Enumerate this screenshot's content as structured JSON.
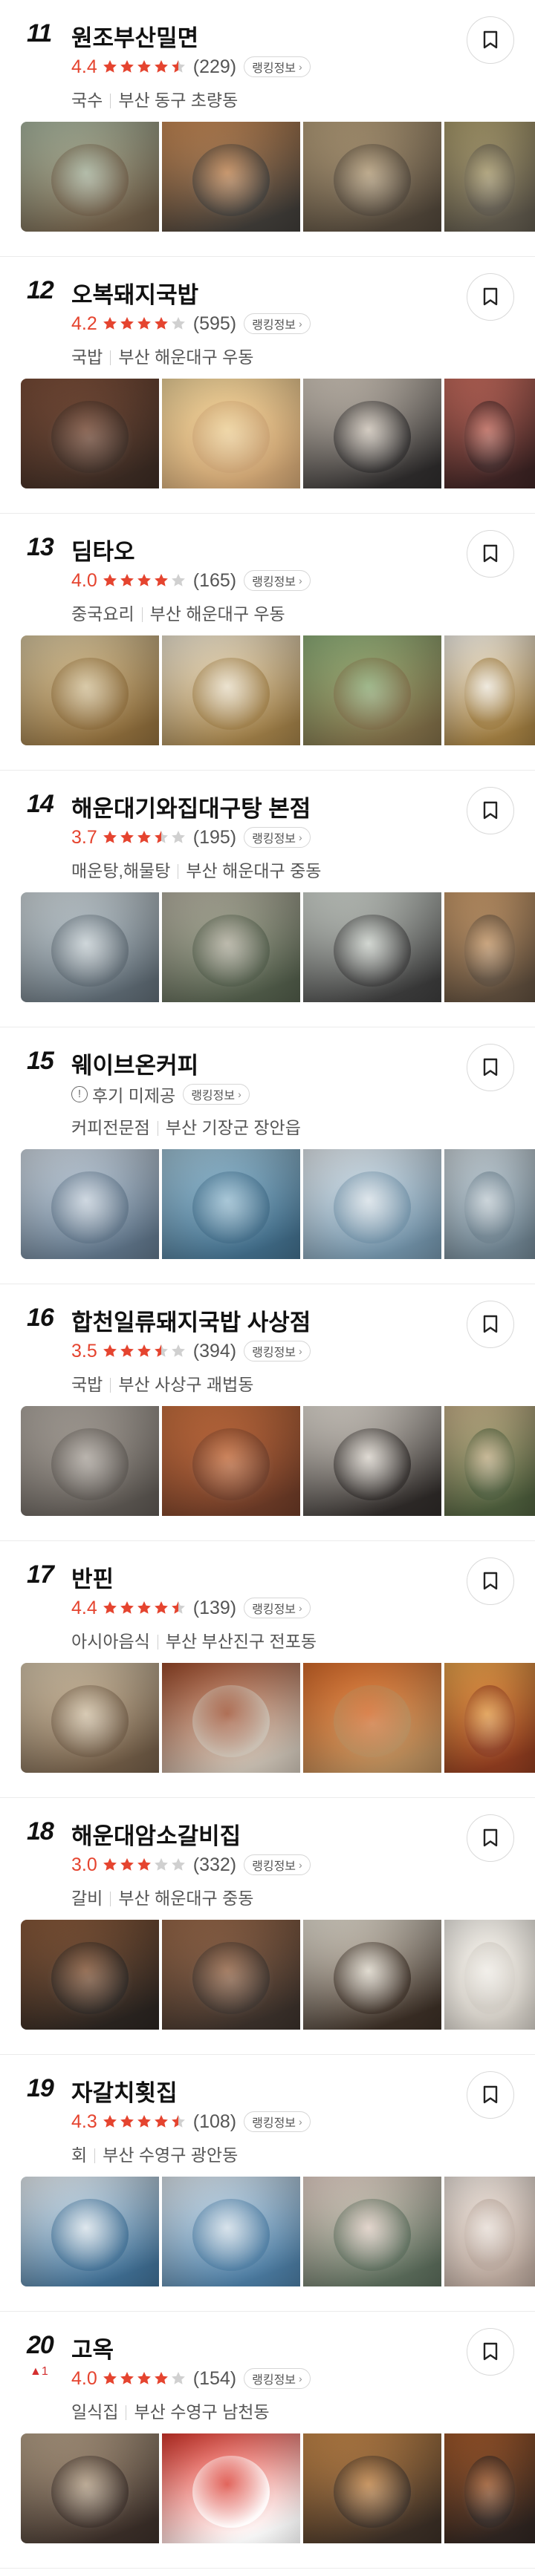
{
  "accent": "#e5442f",
  "star_color": "#e5442f",
  "star_empty": "#d0d0d0",
  "badge_label": "랭킹정보",
  "items": [
    {
      "rank": "11",
      "name": "원조부산밀면",
      "score": "4.4",
      "stars": 4.5,
      "reviews": "(229)",
      "category": "국수",
      "location": "부산 동구 초량동",
      "photos": [
        {
          "subject": "noodle-dishes-table",
          "c1": "#6b5a45",
          "c2": "#a9b7a0"
        },
        {
          "subject": "milmyeon-bowl",
          "c1": "#3d3a36",
          "c2": "#c88a55"
        },
        {
          "subject": "noodles-with-kimchi",
          "c1": "#4e4438",
          "c2": "#b9a27d"
        },
        {
          "subject": "cold-noodle-bowl",
          "c1": "#5a5448",
          "c2": "#a99b6c"
        }
      ]
    },
    {
      "rank": "12",
      "name": "오복돼지국밥",
      "score": "4.2",
      "stars": 4.0,
      "reviews": "(595)",
      "category": "국밥",
      "location": "부산 해운대구 우동",
      "photos": [
        {
          "subject": "soondae-plate",
          "c1": "#3a2a22",
          "c2": "#7a4d38"
        },
        {
          "subject": "noodles-lifted",
          "c1": "#c9a070",
          "c2": "#efd39a"
        },
        {
          "subject": "pork-soup-bowl",
          "c1": "#2d2b2b",
          "c2": "#d9cfc2"
        },
        {
          "subject": "pork-slices",
          "c1": "#3a2222",
          "c2": "#c46a5c"
        }
      ]
    },
    {
      "rank": "13",
      "name": "딤타오",
      "score": "4.0",
      "stars": 4.0,
      "reviews": "(165)",
      "category": "중국요리",
      "location": "부산 해운대구 우동",
      "photos": [
        {
          "subject": "dim-sum-baskets",
          "c1": "#8a6a3a",
          "c2": "#d8c7a0"
        },
        {
          "subject": "har-gow-steamer",
          "c1": "#9b7b45",
          "c2": "#efe6d2"
        },
        {
          "subject": "green-dumplings",
          "c1": "#7b6a45",
          "c2": "#8fb07a"
        },
        {
          "subject": "steamed-buns",
          "c1": "#9c7a3f",
          "c2": "#f3efe6"
        }
      ]
    },
    {
      "rank": "14",
      "name": "해운대기와집대구탕 본점",
      "score": "3.7",
      "stars": 3.5,
      "reviews": "(195)",
      "category": "매운탕,해물탕",
      "location": "부산 해운대구 중동",
      "photos": [
        {
          "subject": "restaurant-exterior",
          "c1": "#5b6770",
          "c2": "#cfd8dc"
        },
        {
          "subject": "hanok-entrance",
          "c1": "#4f5a48",
          "c2": "#b8b4a4"
        },
        {
          "subject": "cod-soup",
          "c1": "#3b3b3b",
          "c2": "#d6dcd5"
        },
        {
          "subject": "side-dishes",
          "c1": "#5a4a3a",
          "c2": "#c89a6a"
        }
      ]
    },
    {
      "rank": "15",
      "name": "웨이브온커피",
      "score": "",
      "stars": 0,
      "reviews": "",
      "no_review": "후기 미제공",
      "category": "커피전문점",
      "location": "부산 기장군 장안읍",
      "photos": [
        {
          "subject": "cafe-building-sky",
          "c1": "#5c7185",
          "c2": "#cfd9e3"
        },
        {
          "subject": "ocean-terrace",
          "c1": "#3f6a86",
          "c2": "#9fc3d6"
        },
        {
          "subject": "seaside-seats",
          "c1": "#6f8fa5",
          "c2": "#e2e9ee"
        },
        {
          "subject": "beach-umbrellas",
          "c1": "#6b7f8c",
          "c2": "#c9d3d9"
        }
      ]
    },
    {
      "rank": "16",
      "name": "합천일류돼지국밥 사상점",
      "score": "3.5",
      "stars": 3.5,
      "reviews": "(394)",
      "category": "국밥",
      "location": "부산 사상구 괘법동",
      "photos": [
        {
          "subject": "street-storefront",
          "c1": "#5a5550",
          "c2": "#b3aca4"
        },
        {
          "subject": "spicy-soup-table",
          "c1": "#6b3a26",
          "c2": "#c9703f"
        },
        {
          "subject": "gukbap-bowl",
          "c1": "#2e2a28",
          "c2": "#e8e2d9"
        },
        {
          "subject": "banchan",
          "c1": "#4a5a3a",
          "c2": "#c7b28a"
        }
      ]
    },
    {
      "rank": "17",
      "name": "반핀",
      "score": "4.4",
      "stars": 4.5,
      "reviews": "(139)",
      "category": "아시아음식",
      "location": "부산 부산진구 전포동",
      "photos": [
        {
          "subject": "menu-board",
          "c1": "#6e5a45",
          "c2": "#d9c9ae"
        },
        {
          "subject": "fried-rice-plate",
          "c1": "#c9bfb2",
          "c2": "#9c4a2a"
        },
        {
          "subject": "curry-dishes",
          "c1": "#b58a5a",
          "c2": "#d66a2a"
        },
        {
          "subject": "mapo-tofu",
          "c1": "#8a3a1e",
          "c2": "#e6a04a"
        }
      ]
    },
    {
      "rank": "18",
      "name": "해운대암소갈비집",
      "score": "3.0",
      "stars": 3.0,
      "reviews": "(332)",
      "category": "갈비",
      "location": "부산 해운대구 중동",
      "photos": [
        {
          "subject": "galbi-grill",
          "c1": "#2a2420",
          "c2": "#8a5a3a"
        },
        {
          "subject": "beef-on-grill",
          "c1": "#3a302a",
          "c2": "#9b6a4a"
        },
        {
          "subject": "menu-frame",
          "c1": "#3a2e25",
          "c2": "#e9e3d6"
        },
        {
          "subject": "price-sign",
          "c1": "#cfcac2",
          "c2": "#f2efe9"
        }
      ]
    },
    {
      "rank": "19",
      "name": "자갈치횟집",
      "score": "4.3",
      "stars": 4.5,
      "reviews": "(108)",
      "category": "회",
      "location": "부산 수영구 광안동",
      "photos": [
        {
          "subject": "course-menu-sign",
          "c1": "#3f6e93",
          "c2": "#e6edf2"
        },
        {
          "subject": "price-menu-sign",
          "c1": "#4a7aa0",
          "c2": "#dce6ee"
        },
        {
          "subject": "sashimi-platter",
          "c1": "#5a6b5a",
          "c2": "#e9d6cc"
        },
        {
          "subject": "raw-fish-slices",
          "c1": "#b7a59a",
          "c2": "#ece3dc"
        }
      ]
    },
    {
      "rank": "20",
      "rank_change": "▲1",
      "name": "고옥",
      "score": "4.0",
      "stars": 4.0,
      "reviews": "(154)",
      "category": "일식집",
      "location": "부산 수영구 남천동",
      "photos": [
        {
          "subject": "restaurant-front",
          "c1": "#3a2e28",
          "c2": "#b9a48a"
        },
        {
          "subject": "location-map",
          "c1": "#ffffff",
          "c2": "#d9362b"
        },
        {
          "subject": "set-meal",
          "c1": "#3a2e25",
          "c2": "#c98a4a"
        },
        {
          "subject": "grilled-eel",
          "c1": "#2e2420",
          "c2": "#a0582a"
        }
      ]
    }
  ]
}
